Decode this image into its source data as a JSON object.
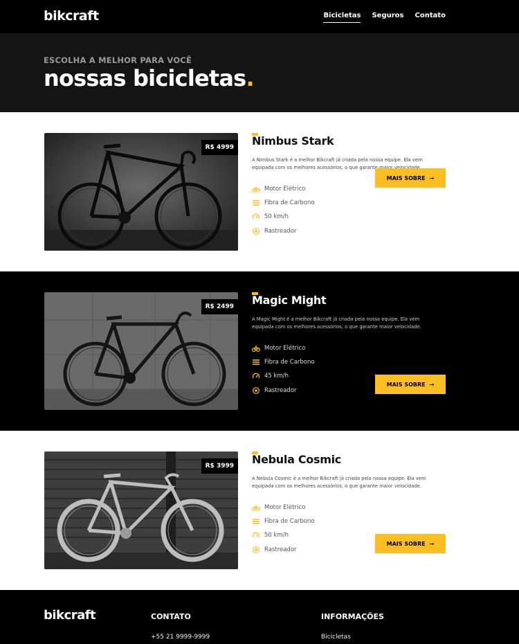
{
  "header": {
    "logo": "bikcraft",
    "nav": [
      "Bicicletas",
      "Seguros",
      "Contato"
    ]
  },
  "hero": {
    "subtitle": "ESCOLHA A MELHOR PARA VOCÊ",
    "title": "nossas bicicletas",
    "title_dot": "."
  },
  "products": [
    {
      "name": "Nimbus Stark",
      "price": "R$ 4999",
      "description": "A Nimbus Stark é a melhor Bikcraft já criada pela nossa equipe. Ela vem equipada com os melhores acessórios, o que garante maior velocidade.",
      "features": [
        "Motor Elétrico",
        "Fibra de Carbono",
        "50 km/h",
        "Rastreador"
      ],
      "button": "MAIS SOBRE",
      "button_icon": "→"
    },
    {
      "name": "Magic Might",
      "price": "R$ 2499",
      "description": "A Magic Might é a melhor Bikcraft já criada pela nossa equipe. Ela vem equipada com os melhores acessórios, o que garante maior velocidade.",
      "features": [
        "Motor Elétrico",
        "Fibra de Carbono",
        "45 km/h",
        "Rastreador"
      ],
      "button": "MAIS SOBRE",
      "button_icon": "→"
    },
    {
      "name": "Nebula Cosmic",
      "price": "R$ 3999",
      "description": "A Nebula Cosmic é a melhor Bikcraft já criada pela nossa equipe. Ela vem equipada com os melhores acessórios, o que garante maior velocidade.",
      "features": [
        "Motor Elétrico",
        "Fibra de Carbono",
        "50 km/h",
        "Rastreador"
      ],
      "button": "MAIS SOBRE",
      "button_icon": "→"
    }
  ],
  "feature_icons": [
    "motor-icon",
    "carbon-fiber-icon",
    "speedometer-icon",
    "tracker-icon"
  ],
  "footer": {
    "logo": "bikcraft",
    "contact_heading": "CONTATO",
    "phone": "+55 21 9999-9999",
    "info_heading": "INFORMAÇÕES",
    "info_link": "Bicicletas"
  },
  "colors": {
    "accent": "#fbbf24",
    "dark": "#000000",
    "hero_bg": "#141414"
  }
}
